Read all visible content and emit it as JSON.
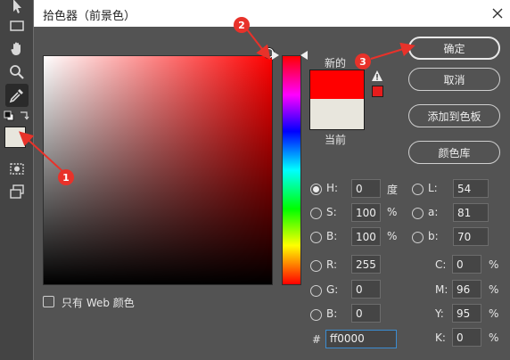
{
  "dialog": {
    "title": "拾色器（前景色）",
    "close_symbol": "✕"
  },
  "preview": {
    "new_label": "新的",
    "current_label": "当前",
    "new_color": "#ff0000",
    "current_color": "#e8e6dd",
    "warning_icon": "warning-icon"
  },
  "buttons": {
    "ok": "确定",
    "cancel": "取消",
    "add_to_swatches": "添加到色板",
    "color_libraries": "颜色库"
  },
  "hsb": {
    "h_label": "H:",
    "h_value": "0",
    "h_unit": "度",
    "s_label": "S:",
    "s_value": "100",
    "s_unit": "%",
    "b_label": "B:",
    "b_value": "100",
    "b_unit": "%"
  },
  "lab": {
    "l_label": "L:",
    "l_value": "54",
    "a_label": "a:",
    "a_value": "81",
    "b_label": "b:",
    "b_value": "70"
  },
  "rgb": {
    "r_label": "R:",
    "r_value": "255",
    "g_label": "G:",
    "g_value": "0",
    "b_label": "B:",
    "b_value": "0"
  },
  "cmyk": {
    "c_label": "C:",
    "c_value": "0",
    "m_label": "M:",
    "m_value": "96",
    "y_label": "Y:",
    "y_value": "95",
    "k_label": "K:",
    "k_value": "0",
    "unit": "%"
  },
  "hex": {
    "label": "#",
    "value": "ff0000"
  },
  "web_only": {
    "label": "只有 Web 颜色",
    "checked": false
  },
  "annotations": {
    "badge_1": "1",
    "badge_2": "2",
    "badge_3": "3",
    "color": "#e8322a"
  },
  "toolbar": {
    "tools": [
      "arrow-icon",
      "rectangle-icon",
      "hand-icon",
      "zoom-icon",
      "eyedropper-icon",
      "quick-mask-icon",
      "screen-mode-icon"
    ]
  }
}
